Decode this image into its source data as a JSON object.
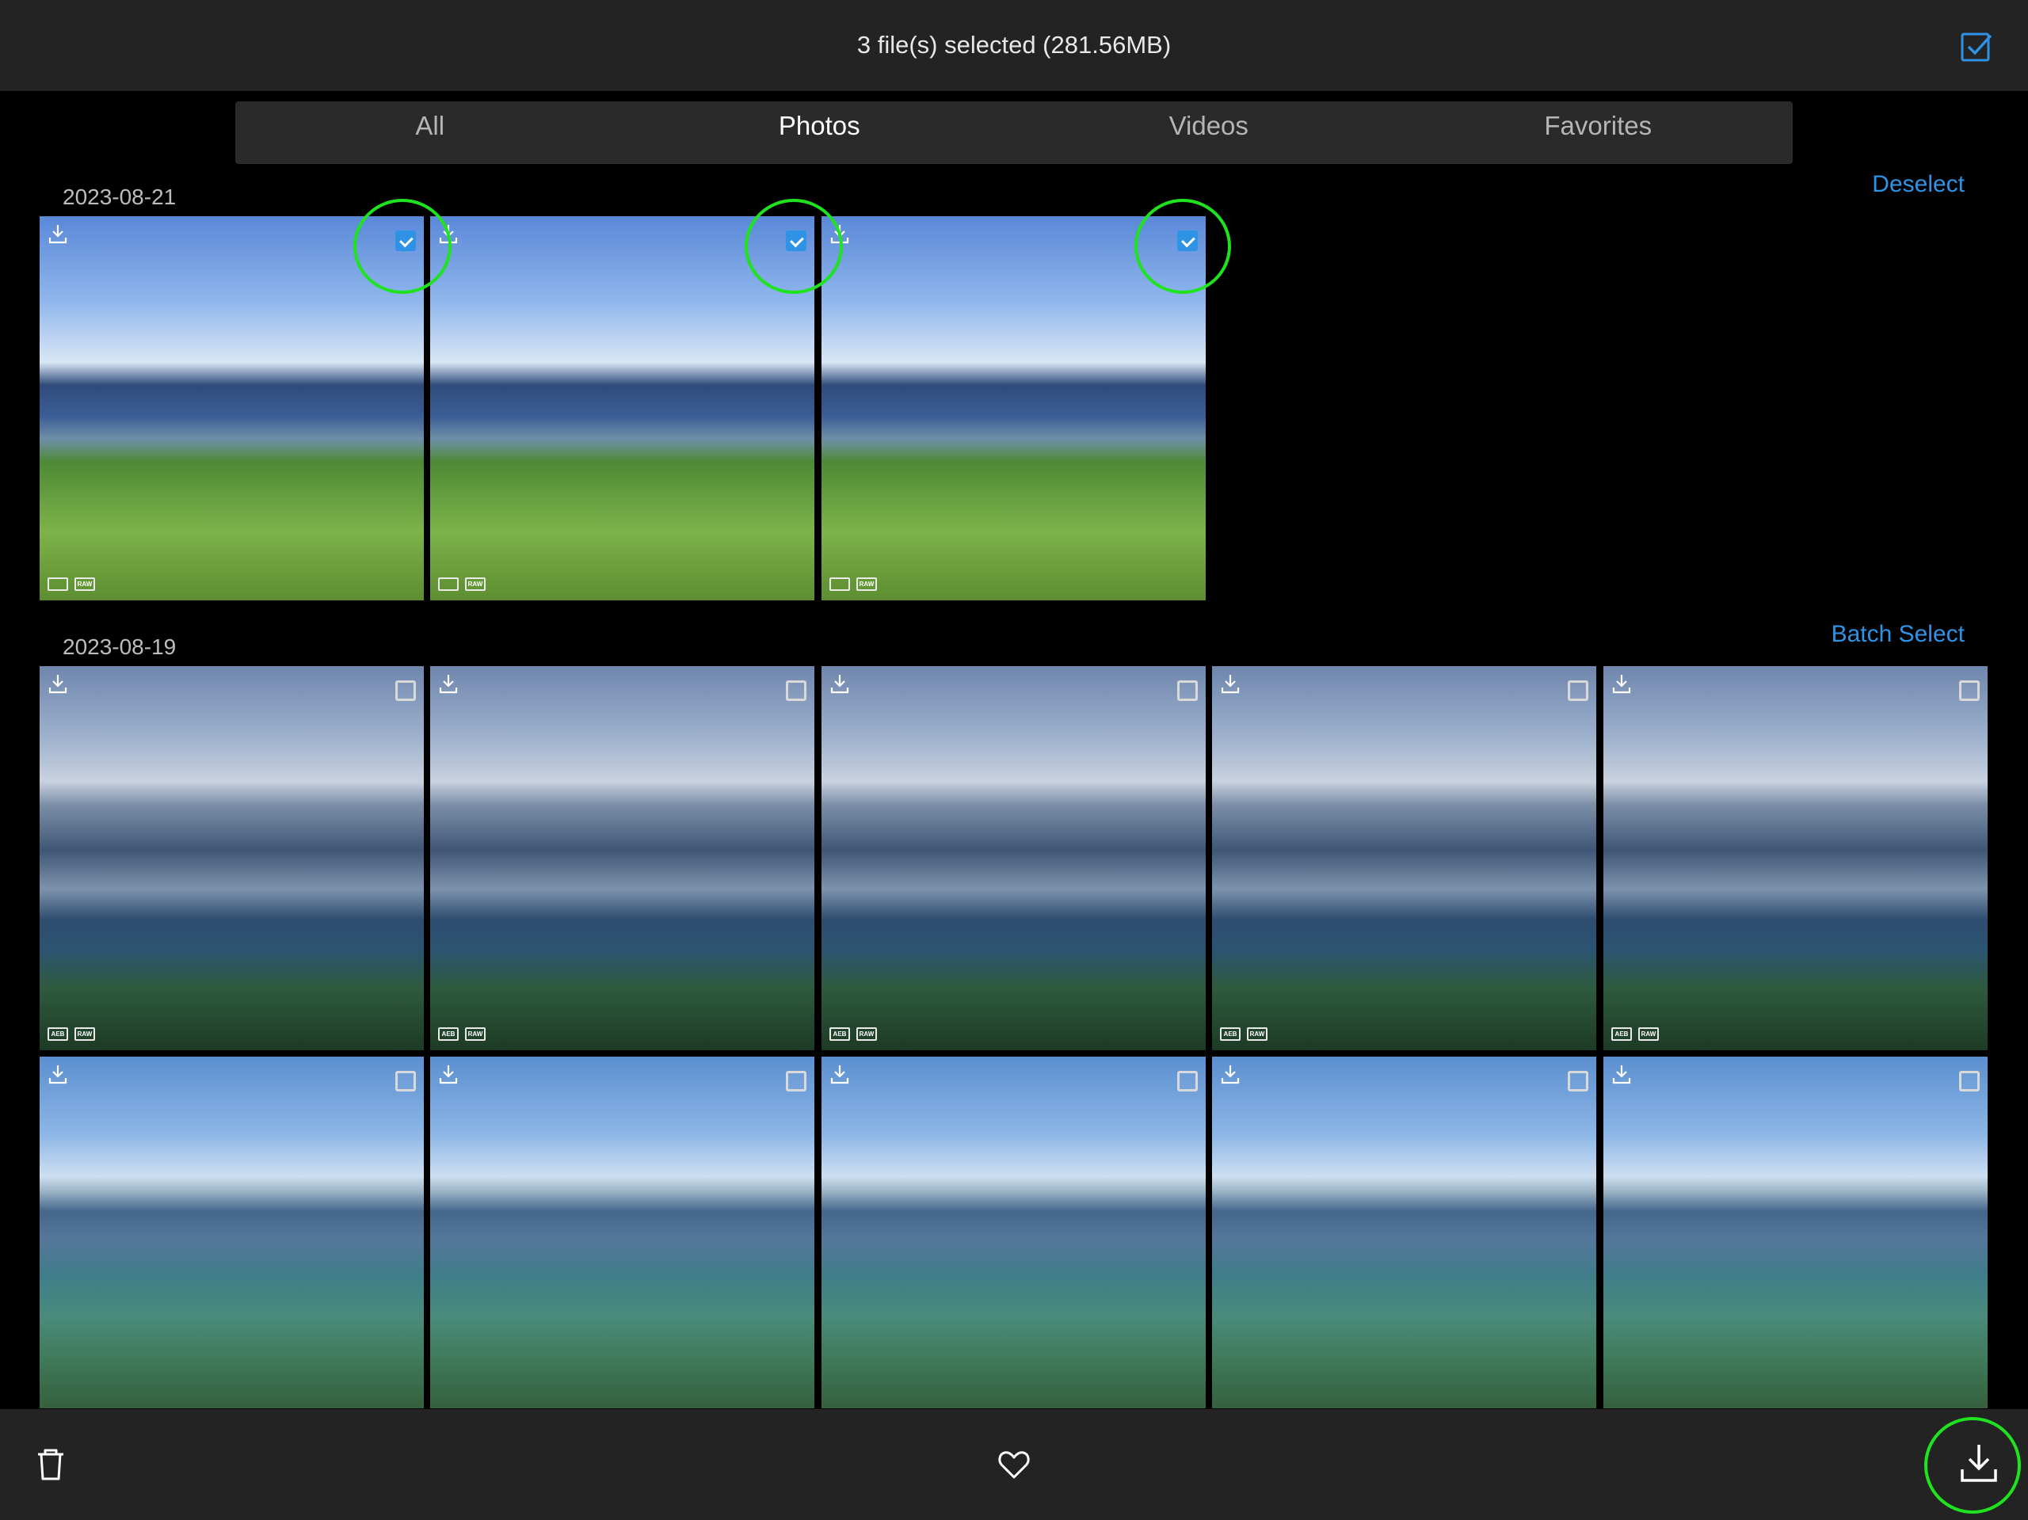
{
  "header": {
    "title": "3 file(s) selected (281.56MB)"
  },
  "tabs": [
    {
      "label": "All",
      "active": false
    },
    {
      "label": "Photos",
      "active": true
    },
    {
      "label": "Videos",
      "active": false
    },
    {
      "label": "Favorites",
      "active": false
    }
  ],
  "sections": [
    {
      "date": "2023-08-21",
      "action": "Deselect"
    },
    {
      "date": "2023-08-19",
      "action": "Batch Select"
    }
  ],
  "badges": {
    "raw": "RAW",
    "aeb": "AEB"
  },
  "icons": {
    "select_all": "checkbox-checked-icon",
    "download_small": "download-icon",
    "delete": "trash-icon",
    "favorite": "heart-icon",
    "download": "download-icon"
  },
  "colors": {
    "accent": "#2f93e5",
    "highlight": "#1ee31e",
    "bar": "#232323"
  },
  "selection": {
    "count": 3
  }
}
